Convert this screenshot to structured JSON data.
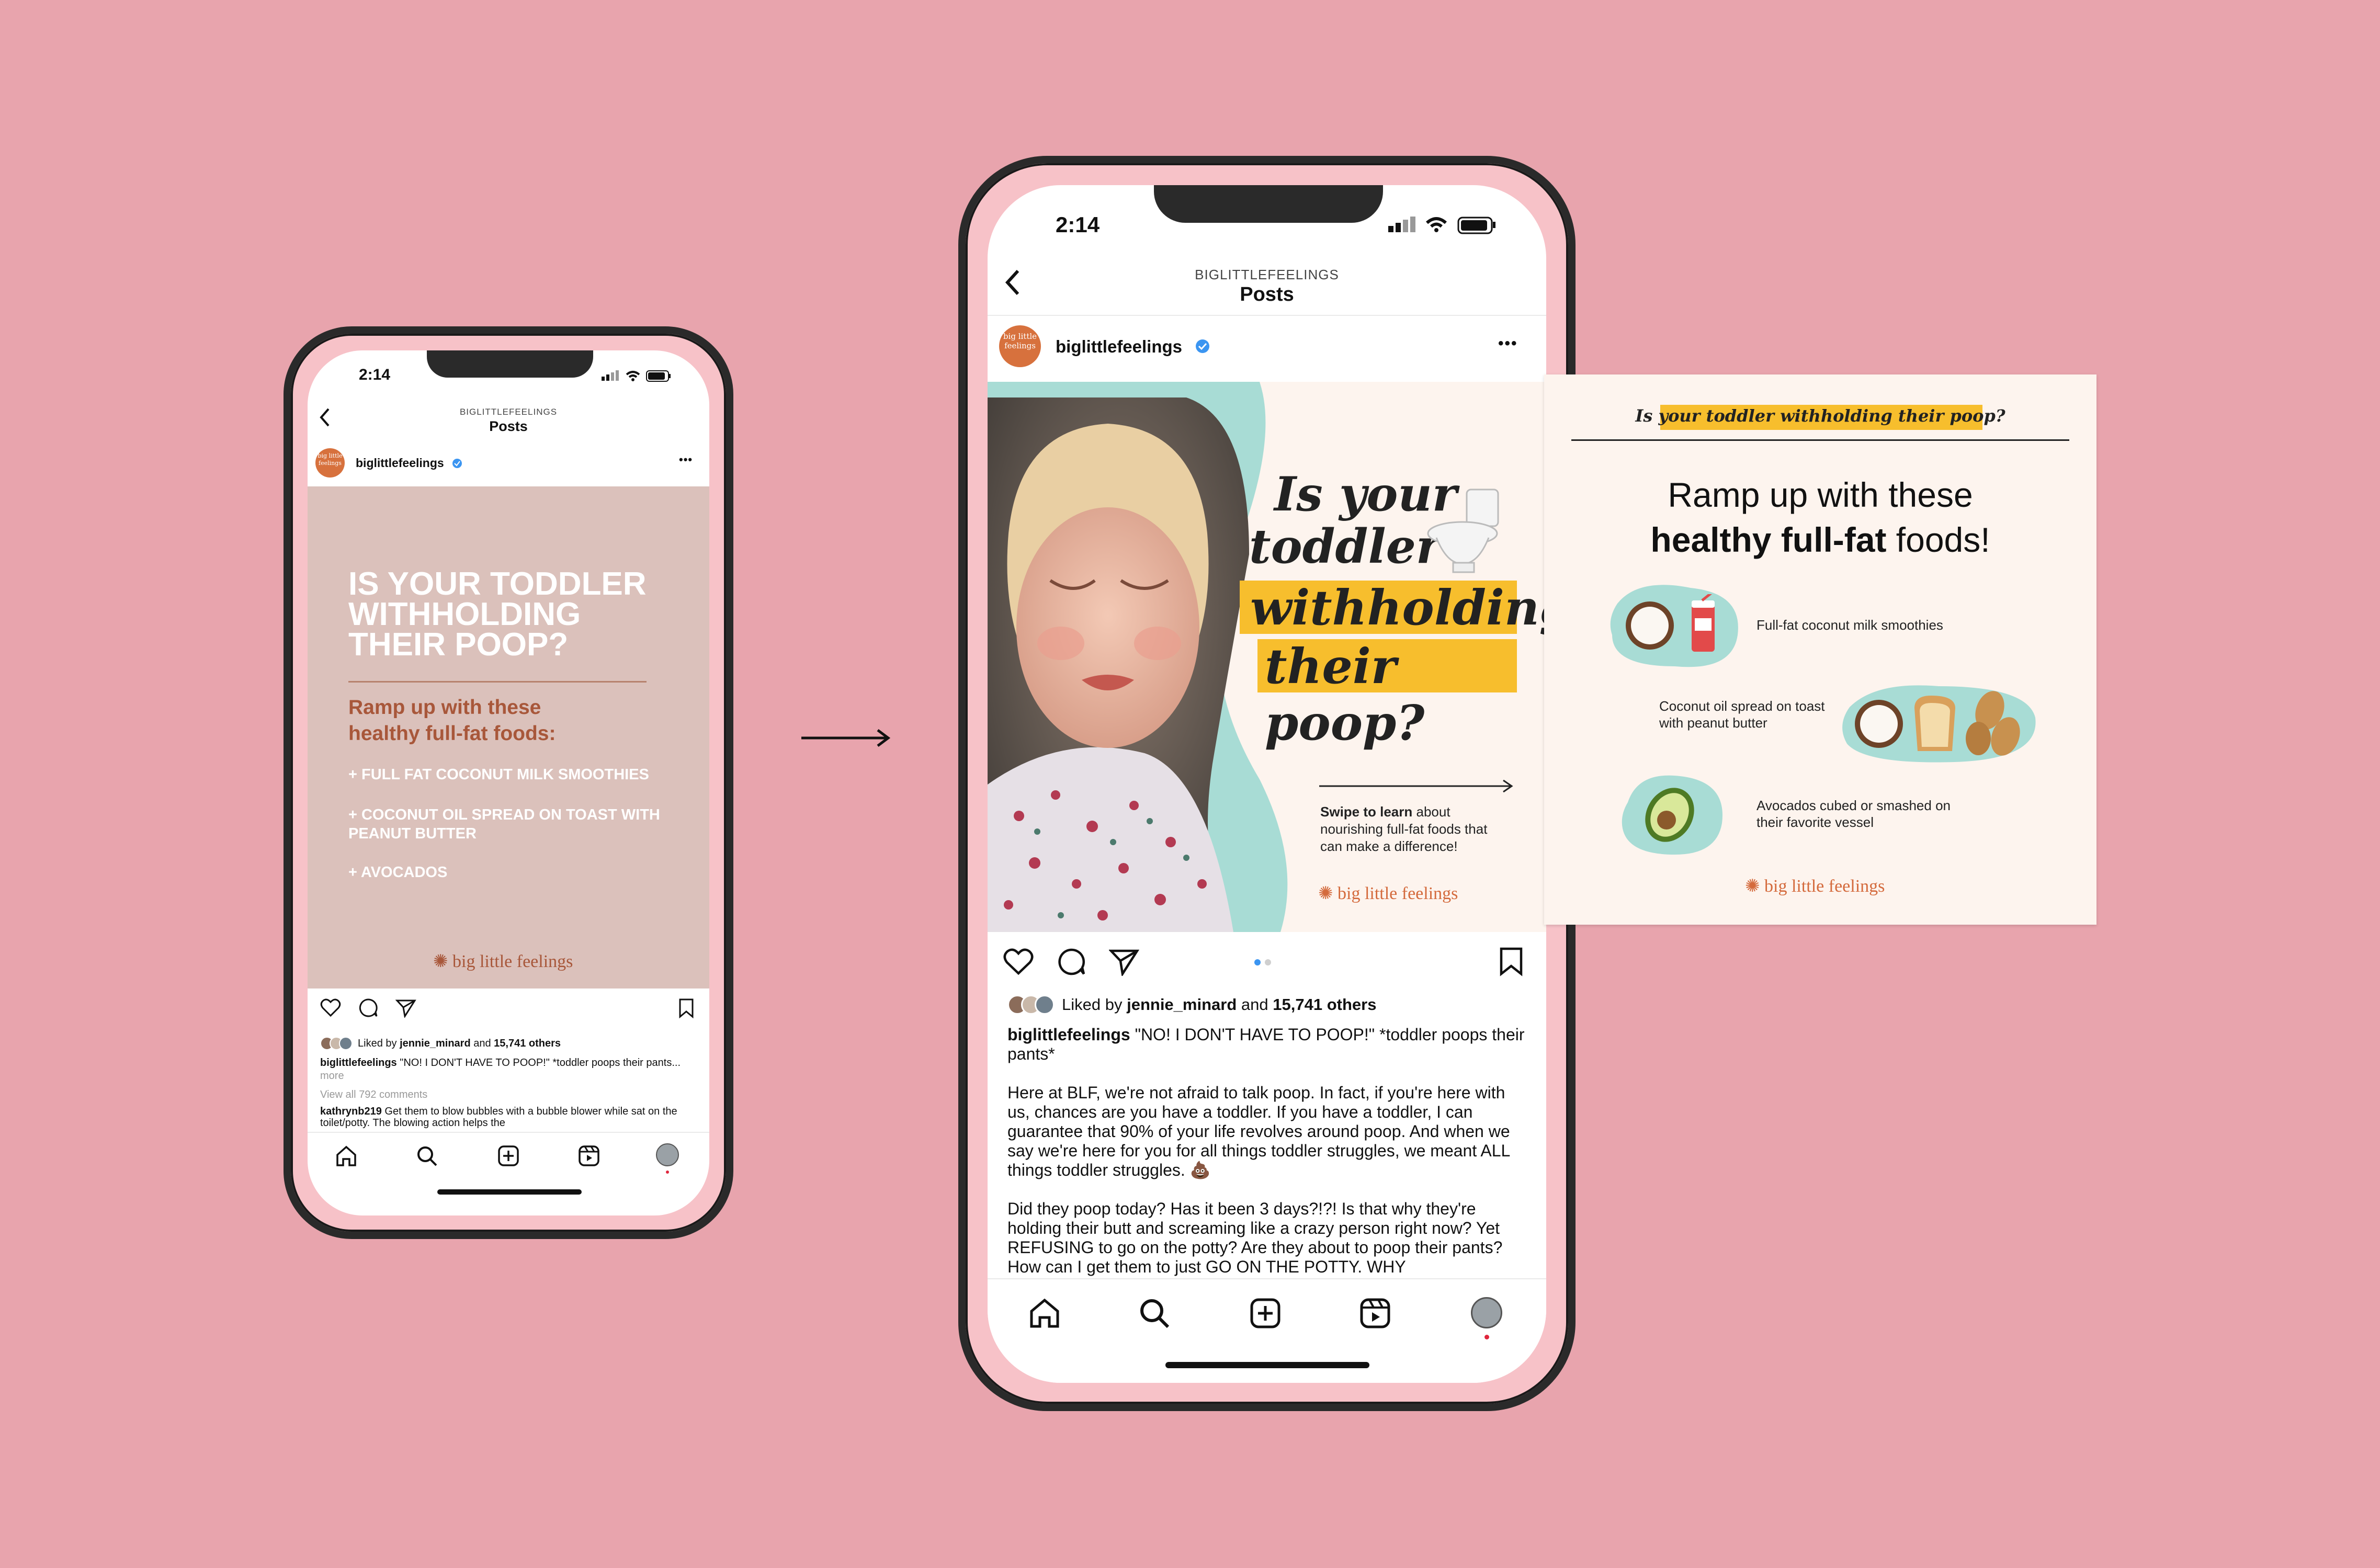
{
  "status": {
    "time": "2:14"
  },
  "header": {
    "account_caps": "BIGLITTLEFEELINGS",
    "title": "Posts"
  },
  "profile": {
    "username": "biglittlefeelings",
    "avatar_text": "big little feelings",
    "more": "•••"
  },
  "small_post": {
    "headline": "IS YOUR TODDLER WITHHOLDING THEIR POOP?",
    "subhead": "Ramp up with these healthy full-fat foods:",
    "items": [
      "+ FULL FAT COCONUT MILK SMOOTHIES",
      "+ COCONUT OIL SPREAD ON TOAST WITH PEANUT BUTTER",
      "+ AVOCADOS"
    ],
    "brand": "big little feelings"
  },
  "engagement": {
    "liked_by": "Liked by",
    "liker": "jennie_minard",
    "and": "and",
    "others": "15,741 others"
  },
  "caption": {
    "username": "biglittlefeelings",
    "text": "\"NO! I DON'T HAVE TO POOP!\" *toddler poops their pants*",
    "short_text": "\"NO! I DON'T HAVE TO POOP!\" *toddler poops their pants...",
    "more": "more",
    "para1": "Here at BLF, we're not afraid to talk poop. In fact, if you're here with us, chances are you have a toddler. If you have a toddler, I can guarantee that 90% of your life revolves around poop. And when we say we're here for you for all things toddler struggles, we meant ALL things toddler struggles. 💩",
    "para2": "Did they poop today? Has it been 3 days?!?! Is that why they're holding their butt and screaming like a crazy person right now? Yet REFUSING to go on the potty? Are they about to poop their pants? How can I get them to just GO ON THE POTTY. WHY"
  },
  "comments": {
    "view_all": "View all 792 comments",
    "commenter": "kathrynb219",
    "comment": "Get them to blow bubbles with a bubble blower while sat on the toilet/potty. The blowing action helps the"
  },
  "slide1": {
    "line1": "Is your",
    "line2": "toddler",
    "line3": "withholding",
    "line4": "their poop?",
    "swipe_bold": "Swipe to learn",
    "swipe_rest": "about nourishing full-fat foods that can make a difference!",
    "brand": "big little feelings"
  },
  "slide2": {
    "tag": "Is your toddler withholding their poop?",
    "title_line1": "Ramp up with these",
    "title_bold": "healthy full-fat",
    "title_end": "foods!",
    "item1": "Full-fat coconut milk smoothies",
    "item2": "Coconut oil spread on toast with peanut butter",
    "item3": "Avocados cubed or smashed on their favorite vessel",
    "brand": "big little feelings"
  },
  "icons": {
    "heart": "heart-icon",
    "comment": "comment-icon",
    "share": "send-icon",
    "bookmark": "bookmark-icon",
    "home": "home-icon",
    "search": "search-icon",
    "add": "add-post-icon",
    "reels": "reels-icon",
    "profile": "profile-avatar-icon"
  },
  "colors": {
    "background": "#e8a4ad",
    "brand_orange": "#d46a3c",
    "highlight_yellow": "#f7be2d",
    "mint_blob": "#a8dcd5",
    "cream": "#fdf4ee",
    "small_post_bg": "#dbc1bb"
  }
}
